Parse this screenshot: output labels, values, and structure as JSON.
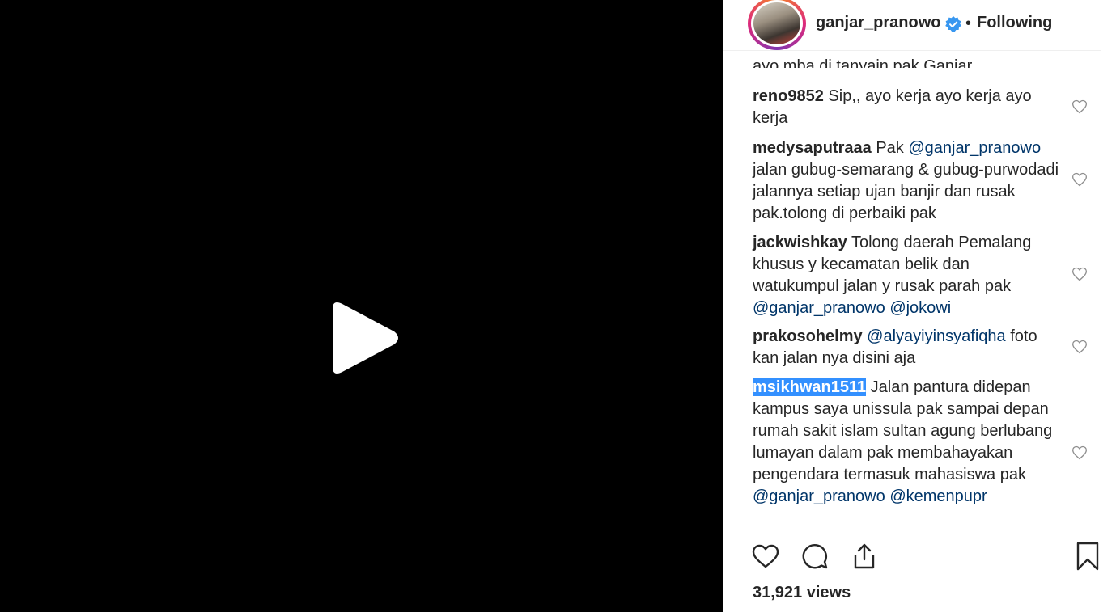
{
  "header": {
    "username": "ganjar_pranowo",
    "separator": "•",
    "follow_status": "Following"
  },
  "partial_comment": "ayo mba di tanyain pak Ganjar",
  "comments": [
    {
      "user": "reno9852",
      "text": "Sip,, ayo kerja ayo kerja ayo kerja"
    },
    {
      "user": "medysaputraaa",
      "pre": "Pak ",
      "mention": "@ganjar_pranowo",
      "text": "jalan gubug-semarang & gubug-purwodadi jalannya setiap ujan banjir dan rusak pak.tolong di perbaiki pak"
    },
    {
      "user": "jackwishkay",
      "text": "Tolong daerah Pemalang khusus y kecamatan belik dan watukumpul jalan y rusak parah pak",
      "mention1": "@ganjar_pranowo",
      "mention2": "@jokowi"
    },
    {
      "user": "prakosohelmy",
      "mention": "@alyayiyinsyafiqha",
      "text": "foto kan jalan nya disini aja"
    },
    {
      "user": "msikhwan1511",
      "text": "Jalan pantura didepan kampus saya unissula pak sampai depan rumah sakit islam sultan agung berlubang lumayan dalam pak membahayakan pengendara termasuk mahasiswa pak",
      "mention1": "@ganjar_pranowo",
      "mention2": "@kemenpupr"
    }
  ],
  "footer": {
    "views": "31,921 views"
  },
  "icons": {
    "play": "play-icon",
    "like": "heart-icon",
    "comment": "comment-bubble-icon",
    "share": "share-icon",
    "save": "bookmark-icon",
    "verified": "verified-badge-icon"
  },
  "colors": {
    "mention": "#003569",
    "highlight": "#3390ff",
    "verified": "#3897f0"
  }
}
